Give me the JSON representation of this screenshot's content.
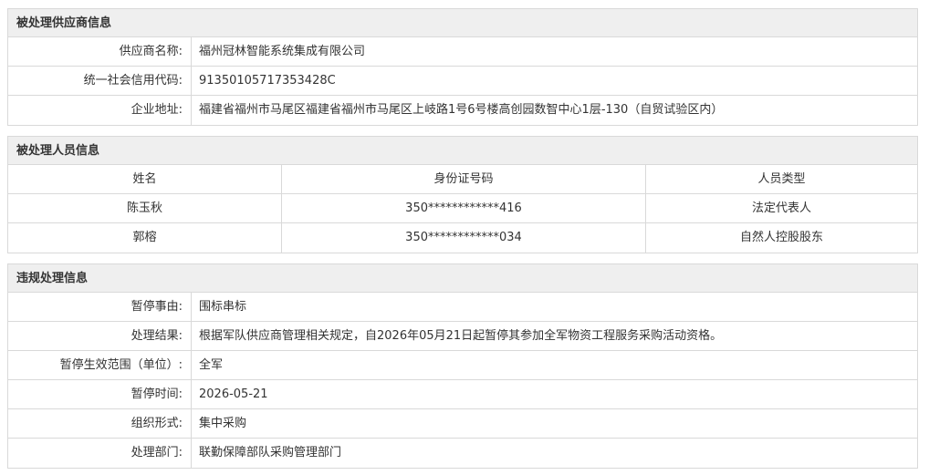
{
  "supplier": {
    "header": "被处理供应商信息",
    "rows": [
      {
        "label": "供应商名称:",
        "value": "福州冠林智能系统集成有限公司"
      },
      {
        "label": "统一社会信用代码:",
        "value": "91350105717353428C"
      },
      {
        "label": "企业地址:",
        "value": "福建省福州市马尾区福建省福州市马尾区上岐路1号6号楼高创园数智中心1层-130（自贸试验区内）"
      }
    ]
  },
  "personnel": {
    "header": "被处理人员信息",
    "columns": [
      "姓名",
      "身份证号码",
      "人员类型"
    ],
    "rows": [
      [
        "陈玉秋",
        "350************416",
        "法定代表人"
      ],
      [
        "郭榕",
        "350************034",
        "自然人控股股东"
      ]
    ]
  },
  "violation": {
    "header": "违规处理信息",
    "rows": [
      {
        "label": "暂停事由:",
        "value": "围标串标"
      },
      {
        "label": "处理结果:",
        "value": "根据军队供应商管理相关规定，自2026年05月21日起暂停其参加全军物资工程服务采购活动资格。"
      },
      {
        "label": "暂停生效范围（单位）:",
        "value": "全军"
      },
      {
        "label": "暂停时间:",
        "value": "2026-05-21"
      },
      {
        "label": "组织形式:",
        "value": "集中采购"
      },
      {
        "label": "处理部门:",
        "value": "联勤保障部队采购管理部门"
      }
    ]
  }
}
